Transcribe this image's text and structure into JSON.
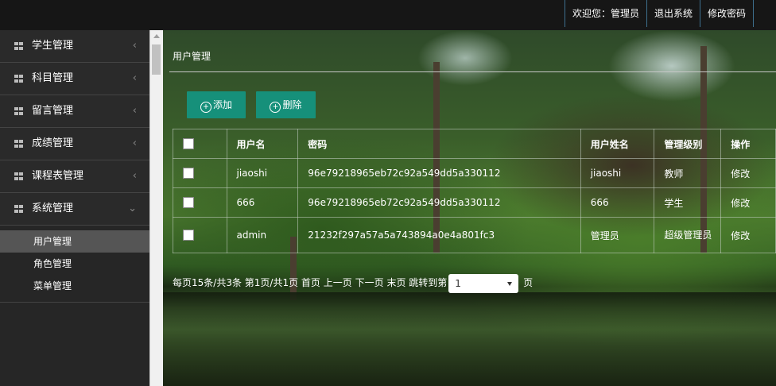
{
  "topnav": {
    "welcome": "欢迎您：管理员",
    "logout": "退出系统",
    "change_password": "修改密码"
  },
  "sidebar": {
    "groups": [
      {
        "label": "学生管理",
        "arrow": "‹"
      },
      {
        "label": "科目管理",
        "arrow": "‹"
      },
      {
        "label": "留言管理",
        "arrow": "‹"
      },
      {
        "label": "成绩管理",
        "arrow": "‹"
      },
      {
        "label": "课程表管理",
        "arrow": "‹"
      },
      {
        "label": "系统管理",
        "arrow": "⌄"
      }
    ],
    "submenu": [
      "用户管理",
      "角色管理",
      "菜单管理"
    ]
  },
  "main": {
    "breadcrumb": "用户管理",
    "add_label": "添加",
    "delete_label": "删除",
    "table": {
      "headers": [
        "用户名",
        "密码",
        "用户姓名",
        "管理级别",
        "操作"
      ],
      "rows": [
        {
          "username": "jiaoshi",
          "password": "96e79218965eb72c92a549dd5a330112",
          "name": "jiaoshi",
          "level": "教师",
          "action": "修改"
        },
        {
          "username": "666",
          "password": "96e79218965eb72c92a549dd5a330112",
          "name": "666",
          "level": "学生",
          "action": "修改"
        },
        {
          "username": "admin",
          "password": "21232f297a57a5a743894a0e4a801fc3",
          "name": "管理员",
          "level": "超级管理员",
          "action": "修改"
        }
      ]
    },
    "pager": {
      "summary": "每页15条/共3条 第1页/共1页",
      "first": "首页",
      "prev": "上一页",
      "next": "下一页",
      "last": "末页",
      "jump_prefix": "跳转到第",
      "page_value": "1",
      "jump_suffix": "页"
    }
  }
}
